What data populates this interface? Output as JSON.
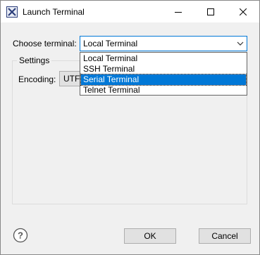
{
  "window": {
    "title": "Launch Terminal",
    "app_icon": "eclipse-x-icon",
    "minimize_icon": "minimize-icon",
    "maximize_icon": "maximize-icon",
    "close_icon": "close-icon"
  },
  "terminal": {
    "label": "Choose terminal:",
    "selected": "Local Terminal",
    "options": [
      "Local Terminal",
      "SSH Terminal",
      "Serial Terminal",
      "Telnet Terminal"
    ],
    "highlighted": "Serial Terminal"
  },
  "settings": {
    "legend": "Settings",
    "encoding_label": "Encoding:",
    "encoding_value": "UTF-"
  },
  "footer": {
    "help_icon": "help-icon",
    "ok_label": "OK",
    "cancel_label": "Cancel"
  },
  "colors": {
    "accent": "#0078d7",
    "dialog_bg": "#f0f0f0",
    "button_bg": "#e1e1e1"
  }
}
